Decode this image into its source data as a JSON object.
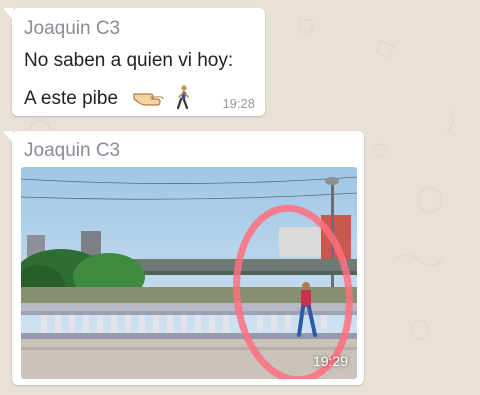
{
  "messages": [
    {
      "sender": "Joaquin C3",
      "lines": [
        "No saben a quien vi hoy:",
        "A este pibe"
      ],
      "emojis": [
        "backhand-index-pointing-left-icon",
        "person-walking-icon"
      ],
      "time": "19:28"
    },
    {
      "sender": "Joaquin C3",
      "attachment": "photo",
      "time": "19:29"
    }
  ],
  "colors": {
    "bubble": "#ffffff",
    "sender": "#8a8a99",
    "wallpaper": "#e7e1d6",
    "highlight_circle": "#ff6f7f"
  }
}
